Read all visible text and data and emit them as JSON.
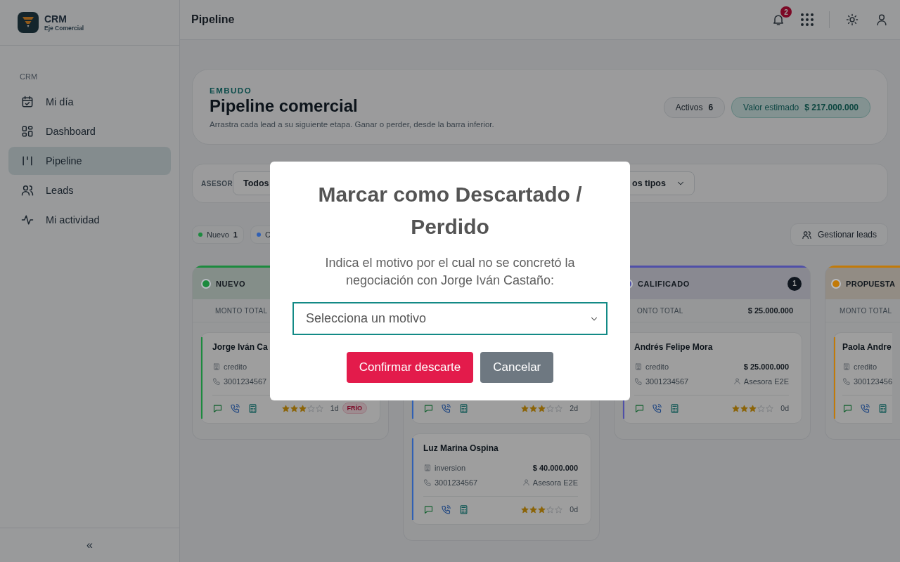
{
  "sidebar": {
    "brand": {
      "title": "CRM",
      "subtitle": "Eje Comercial"
    },
    "section": "CRM",
    "items": [
      {
        "label": "Mi día",
        "selected": false
      },
      {
        "label": "Dashboard",
        "selected": false
      },
      {
        "label": "Pipeline",
        "selected": true
      },
      {
        "label": "Leads",
        "selected": false
      },
      {
        "label": "Mi actividad",
        "selected": false
      }
    ],
    "collapse": "«"
  },
  "topbar": {
    "title": "Pipeline",
    "notifications": "2"
  },
  "hero": {
    "eyebrow": "EMBUDO",
    "title": "Pipeline comercial",
    "subtitle": "Arrastra cada lead a su siguiente etapa. Ganar o perder, desde la barra inferior.",
    "stats": [
      {
        "kind": "plain",
        "label": "Activos",
        "value": "6"
      },
      {
        "kind": "accent",
        "label": "Valor estimado",
        "value": "$ 217.000.000"
      }
    ]
  },
  "filters": {
    "label": "ASESOR",
    "selects": [
      {
        "value": "Todos"
      },
      {
        "value": "os tipos"
      }
    ]
  },
  "stage_chips": [
    {
      "label": "Nuevo",
      "count": "1",
      "color": "#1c8a3e"
    },
    {
      "label": "C",
      "color": "#3060b4"
    }
  ],
  "manage_button": "Gestionar leads",
  "columns": [
    {
      "title": "NUEVO",
      "color": "#1c8a3e",
      "total_label": "MONTO TOTAL",
      "cards": [
        {
          "name": "Jorge Iván Ca",
          "product": "credito",
          "phone": "3001234567",
          "stars": 3,
          "age": "1d",
          "tag": "FRÍO"
        }
      ]
    },
    {
      "color": "#3060b4",
      "cards": [
        {
          "stars": 3,
          "age": "2d"
        },
        {
          "name": "Luz Marina Ospina",
          "product": "inversion",
          "amount": "$ 40.000.000",
          "phone": "3001234567",
          "advisor": "Asesora E2E",
          "stars": 3,
          "age": "0d"
        }
      ]
    },
    {
      "title": "CALIFICADO",
      "count": "1",
      "color": "#4f4fa8",
      "total_label": "ONTO TOTAL",
      "total": "$ 25.000.000",
      "cards": [
        {
          "name": "Andrés Felipe Mora",
          "product": "credito",
          "amount": "$ 25.000.000",
          "phone": "3001234567",
          "advisor": "Asesora E2E",
          "stars": 3,
          "age": "0d"
        }
      ]
    },
    {
      "title": "PROPUESTA",
      "color": "#c27a08",
      "total_label": "MONTO TOTAL",
      "cards": [
        {
          "name": "Paola Andre",
          "product": "credito",
          "phone": "300123456"
        }
      ]
    }
  ],
  "modal": {
    "title": "Marcar como Descartado / Perdido",
    "message": "Indica el motivo por el cual no se concretó la negociación con Jorge Iván Castaño:",
    "select_placeholder": "Selecciona un motivo",
    "buttons": [
      {
        "kind": "danger",
        "label": "Confirmar descarte"
      },
      {
        "kind": "secondary",
        "label": "Cancelar"
      }
    ]
  }
}
